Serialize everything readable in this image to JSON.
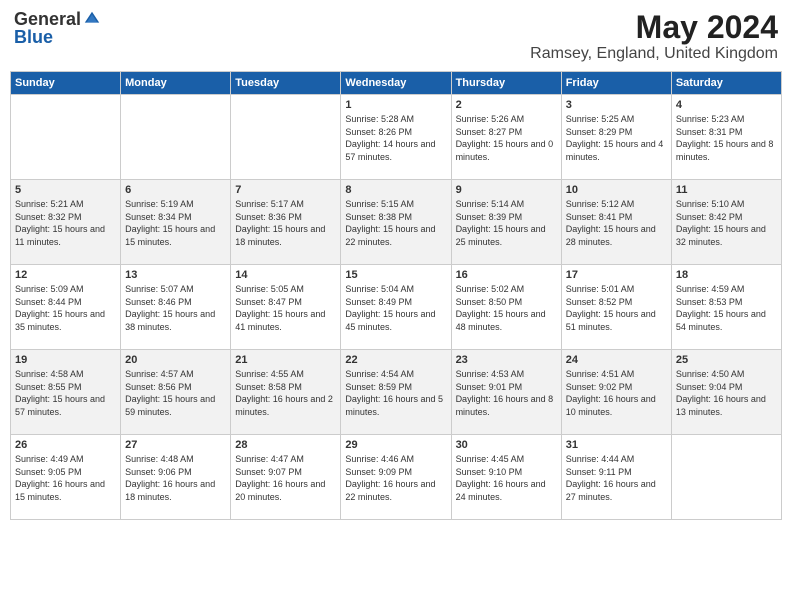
{
  "header": {
    "logo_general": "General",
    "logo_blue": "Blue",
    "month_year": "May 2024",
    "location": "Ramsey, England, United Kingdom"
  },
  "days_of_week": [
    "Sunday",
    "Monday",
    "Tuesday",
    "Wednesday",
    "Thursday",
    "Friday",
    "Saturday"
  ],
  "weeks": [
    [
      {
        "day": "",
        "sunrise": "",
        "sunset": "",
        "daylight": ""
      },
      {
        "day": "",
        "sunrise": "",
        "sunset": "",
        "daylight": ""
      },
      {
        "day": "",
        "sunrise": "",
        "sunset": "",
        "daylight": ""
      },
      {
        "day": "1",
        "sunrise": "Sunrise: 5:28 AM",
        "sunset": "Sunset: 8:26 PM",
        "daylight": "Daylight: 14 hours and 57 minutes."
      },
      {
        "day": "2",
        "sunrise": "Sunrise: 5:26 AM",
        "sunset": "Sunset: 8:27 PM",
        "daylight": "Daylight: 15 hours and 0 minutes."
      },
      {
        "day": "3",
        "sunrise": "Sunrise: 5:25 AM",
        "sunset": "Sunset: 8:29 PM",
        "daylight": "Daylight: 15 hours and 4 minutes."
      },
      {
        "day": "4",
        "sunrise": "Sunrise: 5:23 AM",
        "sunset": "Sunset: 8:31 PM",
        "daylight": "Daylight: 15 hours and 8 minutes."
      }
    ],
    [
      {
        "day": "5",
        "sunrise": "Sunrise: 5:21 AM",
        "sunset": "Sunset: 8:32 PM",
        "daylight": "Daylight: 15 hours and 11 minutes."
      },
      {
        "day": "6",
        "sunrise": "Sunrise: 5:19 AM",
        "sunset": "Sunset: 8:34 PM",
        "daylight": "Daylight: 15 hours and 15 minutes."
      },
      {
        "day": "7",
        "sunrise": "Sunrise: 5:17 AM",
        "sunset": "Sunset: 8:36 PM",
        "daylight": "Daylight: 15 hours and 18 minutes."
      },
      {
        "day": "8",
        "sunrise": "Sunrise: 5:15 AM",
        "sunset": "Sunset: 8:38 PM",
        "daylight": "Daylight: 15 hours and 22 minutes."
      },
      {
        "day": "9",
        "sunrise": "Sunrise: 5:14 AM",
        "sunset": "Sunset: 8:39 PM",
        "daylight": "Daylight: 15 hours and 25 minutes."
      },
      {
        "day": "10",
        "sunrise": "Sunrise: 5:12 AM",
        "sunset": "Sunset: 8:41 PM",
        "daylight": "Daylight: 15 hours and 28 minutes."
      },
      {
        "day": "11",
        "sunrise": "Sunrise: 5:10 AM",
        "sunset": "Sunset: 8:42 PM",
        "daylight": "Daylight: 15 hours and 32 minutes."
      }
    ],
    [
      {
        "day": "12",
        "sunrise": "Sunrise: 5:09 AM",
        "sunset": "Sunset: 8:44 PM",
        "daylight": "Daylight: 15 hours and 35 minutes."
      },
      {
        "day": "13",
        "sunrise": "Sunrise: 5:07 AM",
        "sunset": "Sunset: 8:46 PM",
        "daylight": "Daylight: 15 hours and 38 minutes."
      },
      {
        "day": "14",
        "sunrise": "Sunrise: 5:05 AM",
        "sunset": "Sunset: 8:47 PM",
        "daylight": "Daylight: 15 hours and 41 minutes."
      },
      {
        "day": "15",
        "sunrise": "Sunrise: 5:04 AM",
        "sunset": "Sunset: 8:49 PM",
        "daylight": "Daylight: 15 hours and 45 minutes."
      },
      {
        "day": "16",
        "sunrise": "Sunrise: 5:02 AM",
        "sunset": "Sunset: 8:50 PM",
        "daylight": "Daylight: 15 hours and 48 minutes."
      },
      {
        "day": "17",
        "sunrise": "Sunrise: 5:01 AM",
        "sunset": "Sunset: 8:52 PM",
        "daylight": "Daylight: 15 hours and 51 minutes."
      },
      {
        "day": "18",
        "sunrise": "Sunrise: 4:59 AM",
        "sunset": "Sunset: 8:53 PM",
        "daylight": "Daylight: 15 hours and 54 minutes."
      }
    ],
    [
      {
        "day": "19",
        "sunrise": "Sunrise: 4:58 AM",
        "sunset": "Sunset: 8:55 PM",
        "daylight": "Daylight: 15 hours and 57 minutes."
      },
      {
        "day": "20",
        "sunrise": "Sunrise: 4:57 AM",
        "sunset": "Sunset: 8:56 PM",
        "daylight": "Daylight: 15 hours and 59 minutes."
      },
      {
        "day": "21",
        "sunrise": "Sunrise: 4:55 AM",
        "sunset": "Sunset: 8:58 PM",
        "daylight": "Daylight: 16 hours and 2 minutes."
      },
      {
        "day": "22",
        "sunrise": "Sunrise: 4:54 AM",
        "sunset": "Sunset: 8:59 PM",
        "daylight": "Daylight: 16 hours and 5 minutes."
      },
      {
        "day": "23",
        "sunrise": "Sunrise: 4:53 AM",
        "sunset": "Sunset: 9:01 PM",
        "daylight": "Daylight: 16 hours and 8 minutes."
      },
      {
        "day": "24",
        "sunrise": "Sunrise: 4:51 AM",
        "sunset": "Sunset: 9:02 PM",
        "daylight": "Daylight: 16 hours and 10 minutes."
      },
      {
        "day": "25",
        "sunrise": "Sunrise: 4:50 AM",
        "sunset": "Sunset: 9:04 PM",
        "daylight": "Daylight: 16 hours and 13 minutes."
      }
    ],
    [
      {
        "day": "26",
        "sunrise": "Sunrise: 4:49 AM",
        "sunset": "Sunset: 9:05 PM",
        "daylight": "Daylight: 16 hours and 15 minutes."
      },
      {
        "day": "27",
        "sunrise": "Sunrise: 4:48 AM",
        "sunset": "Sunset: 9:06 PM",
        "daylight": "Daylight: 16 hours and 18 minutes."
      },
      {
        "day": "28",
        "sunrise": "Sunrise: 4:47 AM",
        "sunset": "Sunset: 9:07 PM",
        "daylight": "Daylight: 16 hours and 20 minutes."
      },
      {
        "day": "29",
        "sunrise": "Sunrise: 4:46 AM",
        "sunset": "Sunset: 9:09 PM",
        "daylight": "Daylight: 16 hours and 22 minutes."
      },
      {
        "day": "30",
        "sunrise": "Sunrise: 4:45 AM",
        "sunset": "Sunset: 9:10 PM",
        "daylight": "Daylight: 16 hours and 24 minutes."
      },
      {
        "day": "31",
        "sunrise": "Sunrise: 4:44 AM",
        "sunset": "Sunset: 9:11 PM",
        "daylight": "Daylight: 16 hours and 27 minutes."
      },
      {
        "day": "",
        "sunrise": "",
        "sunset": "",
        "daylight": ""
      }
    ]
  ]
}
